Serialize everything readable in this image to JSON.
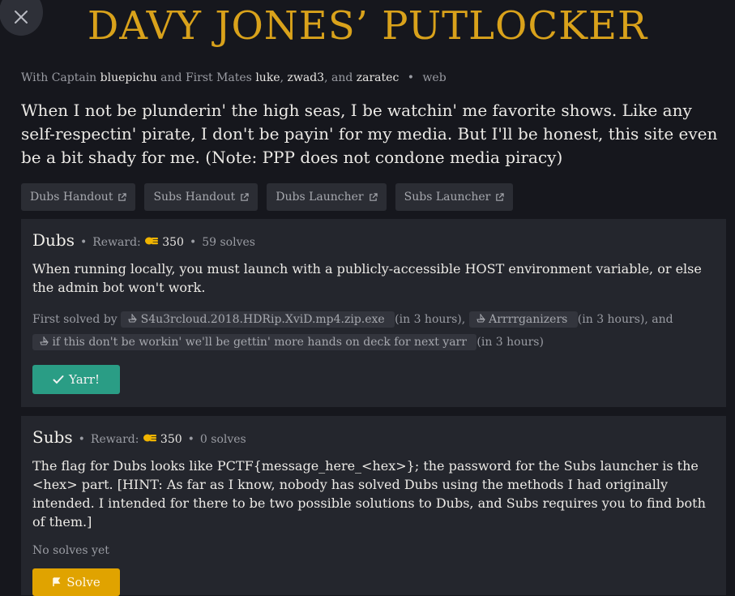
{
  "header": {
    "title": "DAVY JONES’ PUTLOCKER",
    "credits": {
      "captain_prefix": "With Captain",
      "captain": "bluepichu",
      "mates_prefix": "and First Mates",
      "mate1": "luke",
      "comma1": ",",
      "mate2": "zwad3",
      "and_word": ", and",
      "mate3": "zaratec",
      "sep": "•",
      "category": "web"
    },
    "intro": "When I not be plunderin' the high seas, I be watchin' me favorite shows. Like any self-respectin' pirate, I don't be payin' for my media. But I'll be honest, this site even be a bit shady for me. (Note: PPP does not condone media piracy)"
  },
  "links": [
    {
      "label": "Dubs Handout"
    },
    {
      "label": "Subs Handout"
    },
    {
      "label": "Dubs Launcher"
    },
    {
      "label": "Subs Launcher"
    }
  ],
  "dubs": {
    "title": "Dubs",
    "reward_label": "Reward:",
    "reward": "350",
    "solves": "59 solves",
    "sep": "•",
    "description": "When running locally, you must launch with a publicly-accessible HOST environment variable, or else the admin bot won't work.",
    "first_solved_label": "First solved by",
    "solver1": "S4u3rcloud.2018.HDRip.XviD.mp4.zip.exe",
    "time1": "(in 3 hours),",
    "solver2": "Arrrrganizers",
    "time2": "(in 3 hours), and",
    "solver3": "if this don't be workin' we'll be gettin' more hands on deck for next yarr",
    "time3": "(in 3 hours)",
    "button": "Yarr!"
  },
  "subs": {
    "title": "Subs",
    "reward_label": "Reward:",
    "reward": "350",
    "solves": "0 solves",
    "sep": "•",
    "description": "The flag for Dubs looks like PCTF{message_here_<hex>}; the password for the Subs launcher is the <hex> part. [HINT: As far as I know, nobody has solved Dubs using the methods I had originally intended. I intended for there to be two possible solutions to Dubs, and Subs requires you to find both of them.]",
    "no_solves": "No solves yet",
    "button": "Solve"
  },
  "colors": {
    "background": "#16171d",
    "card": "#24262d",
    "title_gold": "#d9a21b",
    "yarr_green": "#2a9d85",
    "solve_gold": "#e0a300"
  },
  "icons": {
    "close": "close-icon",
    "external": "external-link-icon",
    "coins": "coins-icon",
    "check": "check-icon",
    "flag": "flag-icon",
    "ship": "ship-icon"
  }
}
